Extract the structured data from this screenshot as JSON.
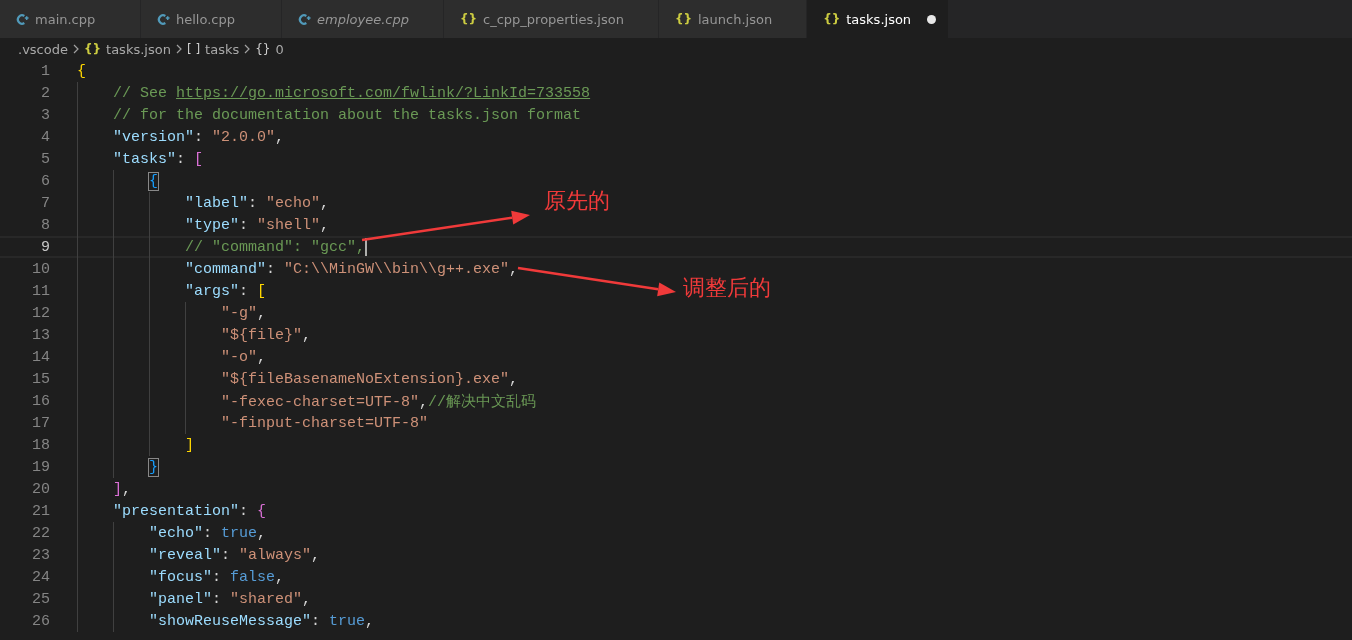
{
  "tabs": [
    {
      "label": "main.cpp",
      "kind": "cpp",
      "selected": false,
      "preview": false,
      "modified": false
    },
    {
      "label": "hello.cpp",
      "kind": "cpp",
      "selected": false,
      "preview": false,
      "modified": false
    },
    {
      "label": "employee.cpp",
      "kind": "cpp",
      "selected": false,
      "preview": true,
      "modified": false
    },
    {
      "label": "c_cpp_properties.json",
      "kind": "json",
      "glyph": "{}",
      "selected": false,
      "preview": false,
      "modified": false
    },
    {
      "label": "launch.json",
      "kind": "json",
      "glyph": "{}",
      "selected": false,
      "preview": false,
      "modified": false
    },
    {
      "label": "tasks.json",
      "kind": "json",
      "glyph": "{}",
      "selected": true,
      "preview": false,
      "modified": true
    }
  ],
  "breadcrumbs": [
    {
      "label": ".vscode"
    },
    {
      "glyph": "{}",
      "kind": "json",
      "label": "tasks.json"
    },
    {
      "glyph": "[ ]",
      "kind": "array",
      "label": "tasks"
    },
    {
      "glyph": "{}",
      "kind": "object",
      "label": "0"
    }
  ],
  "editor": {
    "lines": [
      {
        "number": "1",
        "current": false,
        "tokens": [
          {
            "kind": "b1",
            "text": "{"
          }
        ]
      },
      {
        "number": "2",
        "current": false,
        "tokens": [
          {
            "kind": "comment",
            "text": "    // See "
          },
          {
            "kind": "link",
            "text": "https://go.microsoft.com/fwlink/?LinkId=733558"
          }
        ]
      },
      {
        "number": "3",
        "current": false,
        "tokens": [
          {
            "kind": "comment",
            "text": "    // for the documentation about the tasks.json format"
          }
        ]
      },
      {
        "number": "4",
        "current": false,
        "tokens": [
          {
            "kind": "key",
            "text": "    \"version\""
          },
          {
            "kind": "punc",
            "text": ": "
          },
          {
            "kind": "str",
            "text": "\"2.0.0\""
          },
          {
            "kind": "punc",
            "text": ","
          }
        ]
      },
      {
        "number": "5",
        "current": false,
        "tokens": [
          {
            "kind": "key",
            "text": "    \"tasks\""
          },
          {
            "kind": "punc",
            "text": ": "
          },
          {
            "kind": "b2",
            "text": "["
          }
        ]
      },
      {
        "number": "6",
        "current": false,
        "tokens": [
          {
            "kind": "b3",
            "text": "        {",
            "matched": true
          }
        ]
      },
      {
        "number": "7",
        "current": false,
        "tokens": [
          {
            "kind": "key",
            "text": "            \"label\""
          },
          {
            "kind": "punc",
            "text": ": "
          },
          {
            "kind": "str",
            "text": "\"echo\""
          },
          {
            "kind": "punc",
            "text": ","
          }
        ]
      },
      {
        "number": "8",
        "current": false,
        "tokens": [
          {
            "kind": "key",
            "text": "            \"type\""
          },
          {
            "kind": "punc",
            "text": ": "
          },
          {
            "kind": "str",
            "text": "\"shell\""
          },
          {
            "kind": "punc",
            "text": ","
          }
        ]
      },
      {
        "number": "9",
        "current": true,
        "tokens": [
          {
            "kind": "comment",
            "text": "            // \"command\": \"gcc\","
          }
        ]
      },
      {
        "number": "10",
        "current": false,
        "tokens": [
          {
            "kind": "key",
            "text": "            \"command\""
          },
          {
            "kind": "punc",
            "text": ": "
          },
          {
            "kind": "str",
            "text": "\"C:\\\\MinGW\\\\bin\\\\g++.exe\""
          },
          {
            "kind": "punc",
            "text": ","
          }
        ]
      },
      {
        "number": "11",
        "current": false,
        "tokens": [
          {
            "kind": "key",
            "text": "            \"args\""
          },
          {
            "kind": "punc",
            "text": ": "
          },
          {
            "kind": "b1",
            "text": "["
          }
        ]
      },
      {
        "number": "12",
        "current": false,
        "tokens": [
          {
            "kind": "str",
            "text": "                \"-g\""
          },
          {
            "kind": "punc",
            "text": ","
          }
        ]
      },
      {
        "number": "13",
        "current": false,
        "tokens": [
          {
            "kind": "str",
            "text": "                \"${file}\""
          },
          {
            "kind": "punc",
            "text": ","
          }
        ]
      },
      {
        "number": "14",
        "current": false,
        "tokens": [
          {
            "kind": "str",
            "text": "                \"-o\""
          },
          {
            "kind": "punc",
            "text": ","
          }
        ]
      },
      {
        "number": "15",
        "current": false,
        "tokens": [
          {
            "kind": "str",
            "text": "                \"${fileBasenameNoExtension}.exe\""
          },
          {
            "kind": "punc",
            "text": ","
          }
        ]
      },
      {
        "number": "16",
        "current": false,
        "tokens": [
          {
            "kind": "str",
            "text": "                \"-fexec-charset=UTF-8\""
          },
          {
            "kind": "punc",
            "text": ","
          },
          {
            "kind": "comment",
            "text": "//解决中文乱码"
          }
        ]
      },
      {
        "number": "17",
        "current": false,
        "tokens": [
          {
            "kind": "str",
            "text": "                \"-finput-charset=UTF-8\""
          }
        ]
      },
      {
        "number": "18",
        "current": false,
        "tokens": [
          {
            "kind": "b1",
            "text": "            ]"
          }
        ]
      },
      {
        "number": "19",
        "current": false,
        "tokens": [
          {
            "kind": "b3",
            "text": "        }",
            "matched": true
          }
        ]
      },
      {
        "number": "20",
        "current": false,
        "tokens": [
          {
            "kind": "b2",
            "text": "    ]"
          },
          {
            "kind": "punc",
            "text": ","
          }
        ]
      },
      {
        "number": "21",
        "current": false,
        "tokens": [
          {
            "kind": "key",
            "text": "    \"presentation\""
          },
          {
            "kind": "punc",
            "text": ": "
          },
          {
            "kind": "b2",
            "text": "{"
          }
        ]
      },
      {
        "number": "22",
        "current": false,
        "tokens": [
          {
            "kind": "key",
            "text": "        \"echo\""
          },
          {
            "kind": "punc",
            "text": ": "
          },
          {
            "kind": "bool",
            "text": "true"
          },
          {
            "kind": "punc",
            "text": ","
          }
        ]
      },
      {
        "number": "23",
        "current": false,
        "tokens": [
          {
            "kind": "key",
            "text": "        \"reveal\""
          },
          {
            "kind": "punc",
            "text": ": "
          },
          {
            "kind": "str",
            "text": "\"always\""
          },
          {
            "kind": "punc",
            "text": ","
          }
        ]
      },
      {
        "number": "24",
        "current": false,
        "tokens": [
          {
            "kind": "key",
            "text": "        \"focus\""
          },
          {
            "kind": "punc",
            "text": ": "
          },
          {
            "kind": "bool",
            "text": "false"
          },
          {
            "kind": "punc",
            "text": ","
          }
        ]
      },
      {
        "number": "25",
        "current": false,
        "tokens": [
          {
            "kind": "key",
            "text": "        \"panel\""
          },
          {
            "kind": "punc",
            "text": ": "
          },
          {
            "kind": "str",
            "text": "\"shared\""
          },
          {
            "kind": "punc",
            "text": ","
          }
        ]
      },
      {
        "number": "26",
        "current": false,
        "tokens": [
          {
            "kind": "key",
            "text": "        \"showReuseMessage\""
          },
          {
            "kind": "punc",
            "text": ": "
          },
          {
            "kind": "bool",
            "text": "true"
          },
          {
            "kind": "punc",
            "text": ","
          }
        ]
      }
    ]
  },
  "annotations": [
    {
      "text": "原先的"
    },
    {
      "text": "调整后的"
    }
  ]
}
